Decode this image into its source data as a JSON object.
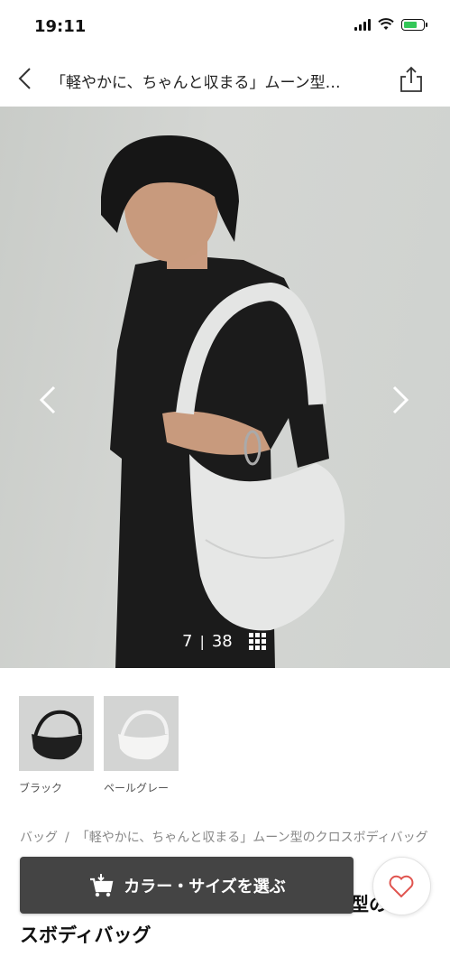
{
  "status_bar": {
    "time": "19:11"
  },
  "header": {
    "title": "「軽やかに、ちゃんと収まる」ムーン型…"
  },
  "gallery": {
    "current": "7",
    "separator": "|",
    "total": "38"
  },
  "colors": [
    {
      "label": "ブラック"
    },
    {
      "label": "ペールグレー"
    }
  ],
  "breadcrumb": {
    "items": [
      "バッグ",
      "「軽やかに、ちゃんと収まる」ムーン型のクロスボディバッグ"
    ],
    "separator": "/"
  },
  "product": {
    "title_tail": "型の",
    "title_line2": "スボディバッグ"
  },
  "cta": {
    "label": "カラー・サイズを選ぶ"
  },
  "theme": {
    "cta_bg": "#444444",
    "favorite_accent": "#e0544f",
    "battery": "#34c759"
  },
  "icons": [
    "back-chevron-icon",
    "share-icon",
    "cart-icon",
    "heart-icon",
    "grid-icon",
    "chevron-left-icon",
    "chevron-right-icon"
  ]
}
